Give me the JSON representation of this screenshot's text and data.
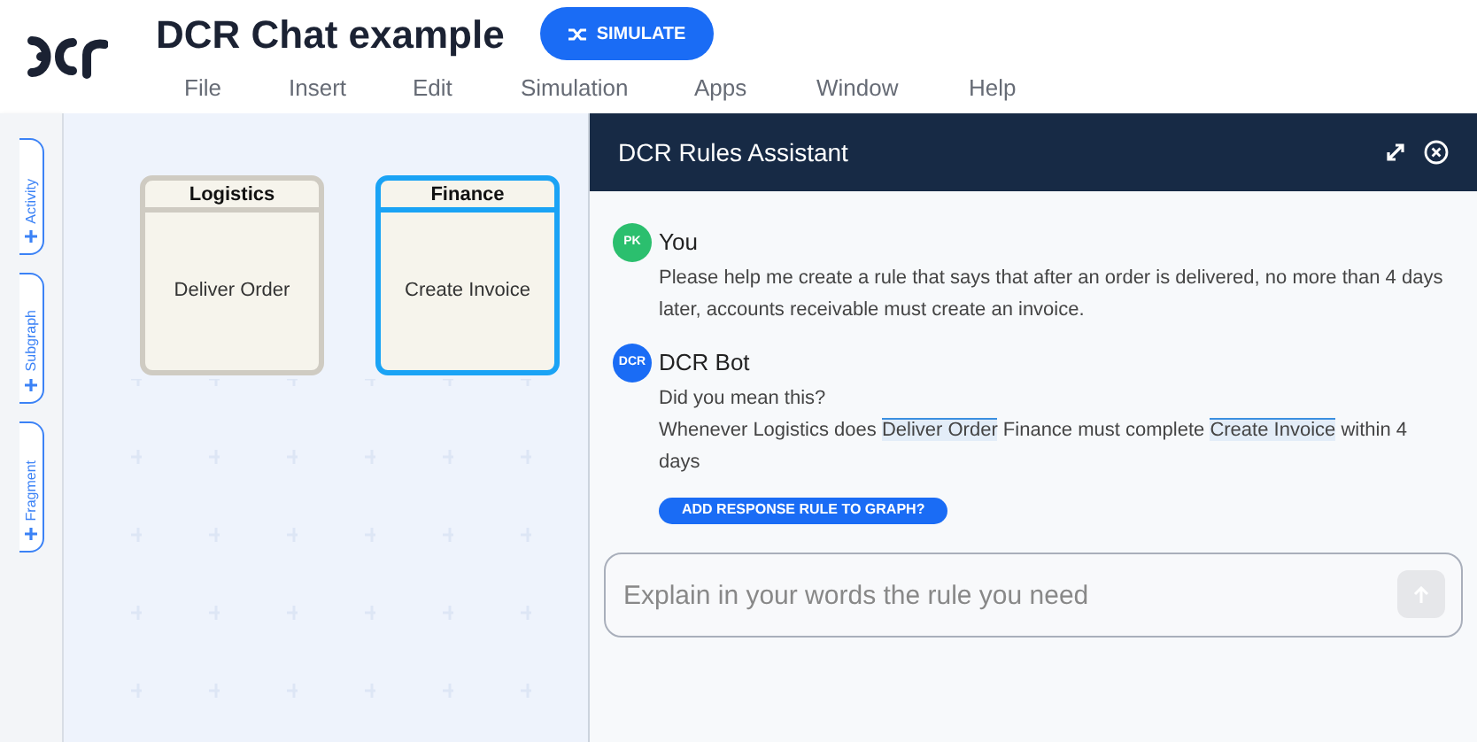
{
  "app": {
    "title": "DCR Chat example",
    "simulate_button": "SIMULATE"
  },
  "menu": [
    "File",
    "Insert",
    "Edit",
    "Simulation",
    "Apps",
    "Window",
    "Help"
  ],
  "sidebar_tabs": [
    {
      "label": "Activity"
    },
    {
      "label": "Subgraph"
    },
    {
      "label": "Fragment"
    }
  ],
  "nodes": [
    {
      "role": "Logistics",
      "activity": "Deliver Order",
      "selected": false
    },
    {
      "role": "Finance",
      "activity": "Create Invoice",
      "selected": true
    }
  ],
  "assistant": {
    "title": "DCR Rules Assistant",
    "messages": [
      {
        "kind": "user",
        "avatar": "PK",
        "author": "You",
        "lines": [
          [
            {
              "text": "Please help me create a rule that says that after an order is delivered, no more than 4 days later, accounts receivable must create an invoice.",
              "kind": "plain"
            }
          ]
        ]
      },
      {
        "kind": "bot",
        "avatar": "DCR",
        "author": "DCR Bot",
        "lines": [
          [
            {
              "text": "Did you mean this?",
              "kind": "plain"
            }
          ],
          [
            {
              "text": "Whenever Logistics does ",
              "kind": "plain"
            },
            {
              "text": "Deliver Order",
              "kind": "ref"
            },
            {
              "text": " Finance must complete ",
              "kind": "plain"
            },
            {
              "text": "Create Invoice",
              "kind": "ref"
            },
            {
              "text": " within 4 days",
              "kind": "plain"
            }
          ]
        ],
        "action": "ADD RESPONSE RULE TO GRAPH?"
      }
    ],
    "input": {
      "placeholder": "Explain in your words the rule you need"
    }
  }
}
